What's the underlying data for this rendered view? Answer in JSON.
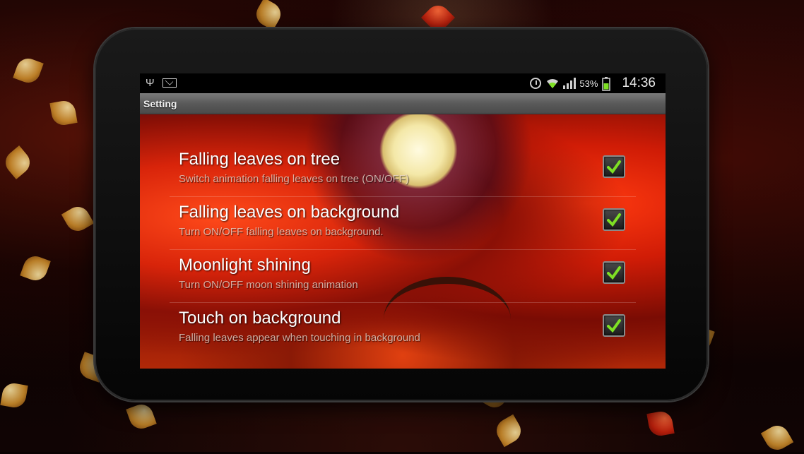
{
  "statusbar": {
    "battery_percent": "53%",
    "time": "14:36",
    "icons": [
      "usb-icon",
      "email-icon",
      "alarm-icon",
      "wifi-icon",
      "signal-icon",
      "battery-icon"
    ]
  },
  "titlebar": {
    "title": "Setting"
  },
  "preferences": [
    {
      "title": "Falling leaves on tree",
      "summary": "Switch animation falling leaves on tree (ON/OFF)",
      "checked": true
    },
    {
      "title": "Falling leaves on background",
      "summary": "Turn ON/OFF falling leaves on background.",
      "checked": true
    },
    {
      "title": "Moonlight shining",
      "summary": "Turn ON/OFF moon shining animation",
      "checked": true
    },
    {
      "title": "Touch on background",
      "summary": "Falling leaves appear when touching in background",
      "checked": true
    }
  ],
  "colors": {
    "check": "#7ee024",
    "accent_red": "#d8240a",
    "moon": "#f4e8a8"
  }
}
